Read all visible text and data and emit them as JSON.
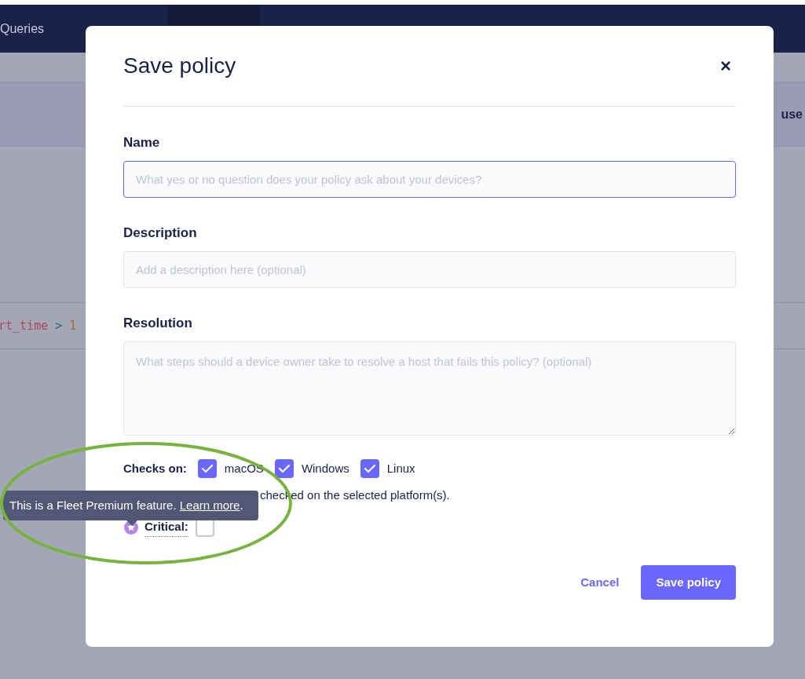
{
  "nav": {
    "tabs": [
      {
        "label": "Queries",
        "selected": false
      }
    ]
  },
  "background": {
    "banner_text": "use",
    "code_tokens": [
      {
        "text": "rt_time",
        "kind": "identifier"
      },
      {
        "text": ">",
        "kind": "operator"
      },
      {
        "text": "1",
        "kind": "number"
      }
    ]
  },
  "modal": {
    "title": "Save policy",
    "close": "×",
    "fields": [
      {
        "label": "Name",
        "placeholder": "What yes or no question does your policy ask about your devices?",
        "kind": "input",
        "focused": true
      },
      {
        "label": "Description",
        "placeholder": "Add a description here (optional)",
        "kind": "input",
        "focused": false
      },
      {
        "label": "Resolution",
        "placeholder": "What steps should a device owner take to resolve a host that fails this policy? (optional)",
        "kind": "textarea",
        "focused": false
      }
    ],
    "platforms": {
      "label": "Checks on:",
      "options": [
        {
          "label": "macOS",
          "checked": true
        },
        {
          "label": "Windows",
          "checked": true
        },
        {
          "label": "Linux",
          "checked": true
        }
      ]
    },
    "help_text": "checked on the selected platform(s).",
    "critical": {
      "label": "Critical:",
      "checked": false
    },
    "tooltip": {
      "text": "This is a Fleet Premium feature. ",
      "link": "Learn more",
      "after": "."
    },
    "buttons": [
      {
        "label": "Cancel",
        "kind": "secondary"
      },
      {
        "label": "Save policy",
        "kind": "primary"
      }
    ]
  }
}
